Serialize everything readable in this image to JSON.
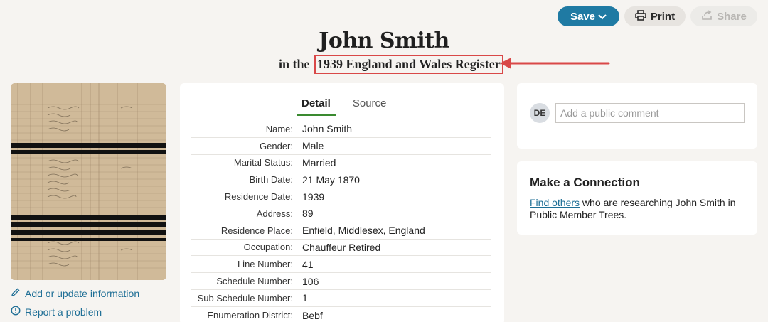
{
  "toolbar": {
    "save_label": "Save",
    "print_label": "Print",
    "share_label": "Share"
  },
  "header": {
    "person_name": "John Smith",
    "subtitle_prefix": "in the",
    "collection": "1939 England and Wales Register"
  },
  "sidebar": {
    "add_update_label": "Add or update information",
    "report_problem_label": "Report a problem"
  },
  "detail": {
    "tabs": [
      {
        "label": "Detail",
        "active": true
      },
      {
        "label": "Source",
        "active": false
      }
    ],
    "rows": [
      {
        "label": "Name:",
        "value": "John Smith"
      },
      {
        "label": "Gender:",
        "value": "Male"
      },
      {
        "label": "Marital Status:",
        "value": "Married"
      },
      {
        "label": "Birth Date:",
        "value": "21 May 1870"
      },
      {
        "label": "Residence Date:",
        "value": "1939"
      },
      {
        "label": "Address:",
        "value": "89"
      },
      {
        "label": "Residence Place:",
        "value": "Enfield, Middlesex, England"
      },
      {
        "label": "Occupation:",
        "value": "Chauffeur Retired"
      },
      {
        "label": "Line Number:",
        "value": "41"
      },
      {
        "label": "Schedule Number:",
        "value": "106"
      },
      {
        "label": "Sub Schedule Number:",
        "value": "1"
      },
      {
        "label": "Enumeration District:",
        "value": "Bebf"
      }
    ]
  },
  "comments": {
    "avatar_initials": "DE",
    "placeholder": "Add a public comment"
  },
  "connection": {
    "title": "Make a Connection",
    "link_text": "Find others",
    "text_rest": " who are researching John Smith in Public Member Trees."
  },
  "colors": {
    "accent": "#1f7aa3",
    "link": "#1f6f96",
    "tab_active": "#3a8a30",
    "highlight": "#d94848"
  },
  "icons": [
    "chevron-down-icon",
    "printer-icon",
    "share-icon",
    "pencil-icon",
    "info-circle-icon",
    "arrow-left-icon"
  ]
}
